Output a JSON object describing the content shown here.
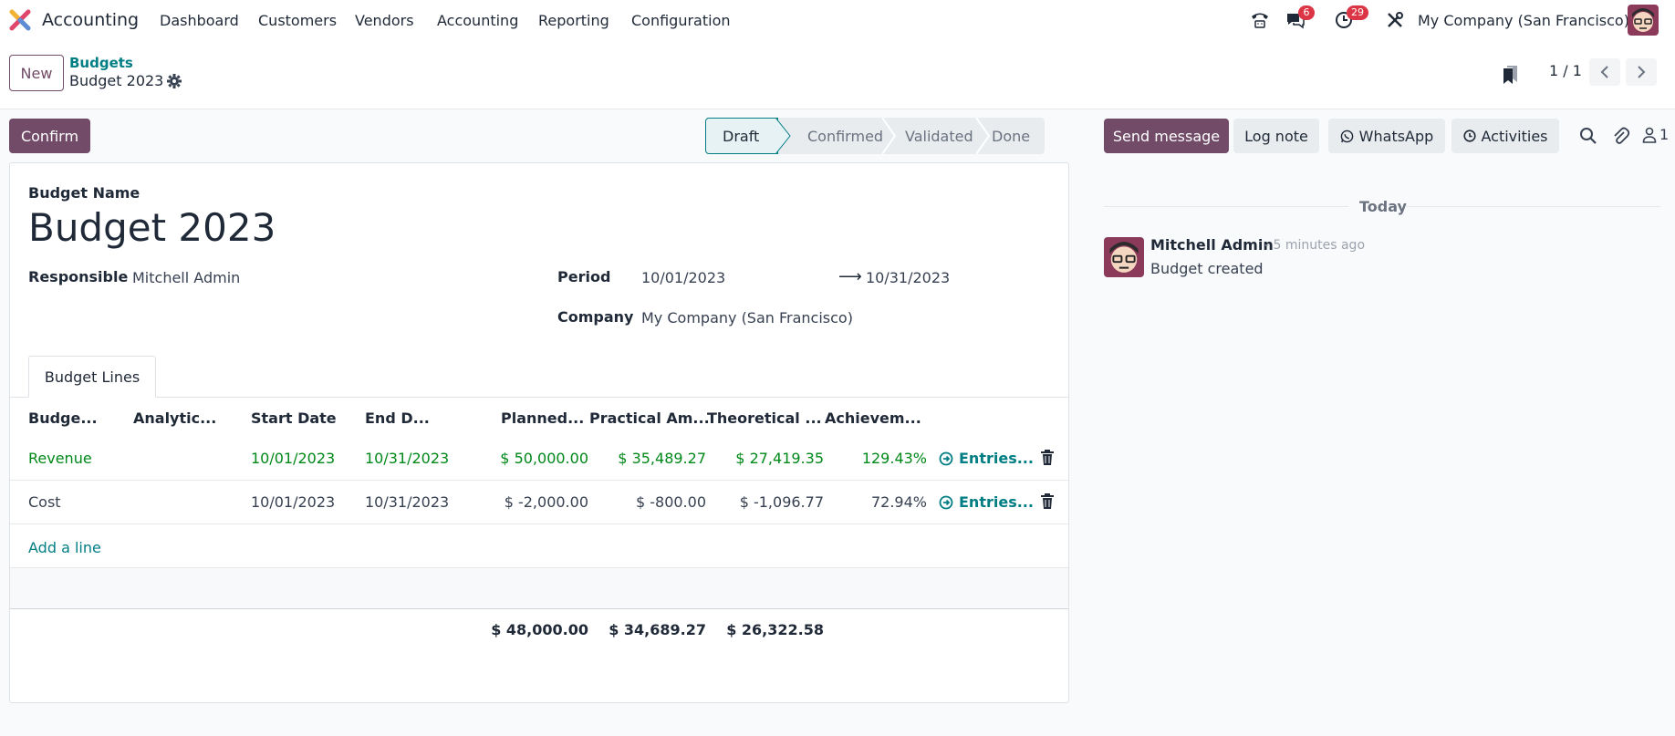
{
  "navbar": {
    "app_name": "Accounting",
    "menu": [
      "Dashboard",
      "Customers",
      "Vendors",
      "Accounting",
      "Reporting",
      "Configuration"
    ],
    "messages_badge": "6",
    "activities_badge": "29",
    "company": "My Company (San Francisco)"
  },
  "control_panel": {
    "new_label": "New",
    "breadcrumb": "Budgets",
    "record_title": "Budget 2023",
    "pager": "1 / 1"
  },
  "statusbar": {
    "confirm_label": "Confirm",
    "stages": [
      "Draft",
      "Confirmed",
      "Validated",
      "Done"
    ],
    "active_stage": "Draft"
  },
  "form": {
    "budget_name_label": "Budget Name",
    "budget_name": "Budget 2023",
    "responsible_label": "Responsible",
    "responsible": "Mitchell Admin",
    "period_label": "Period",
    "period_start": "10/01/2023",
    "period_end": "10/31/2023",
    "company_label": "Company",
    "company": "My Company (San Francisco)",
    "tab_label": "Budget Lines",
    "columns": [
      "Budge...",
      "Analytic...",
      "Start Date",
      "End D...",
      "Planned...",
      "Practical Am...",
      "Theoretical ...",
      "Achievem..."
    ],
    "rows": [
      {
        "budget": "Revenue",
        "analytic": "",
        "start": "10/01/2023",
        "end": "10/31/2023",
        "planned": "$ 50,000.00",
        "practical": "$ 35,489.27",
        "theoretical": "$ 27,419.35",
        "achievement": "129.43%",
        "entries": "Entries..."
      },
      {
        "budget": "Cost",
        "analytic": "",
        "start": "10/01/2023",
        "end": "10/31/2023",
        "planned": "$ -2,000.00",
        "practical": "$ -800.00",
        "theoretical": "$ -1,096.77",
        "achievement": "72.94%",
        "entries": "Entries..."
      }
    ],
    "add_line": "Add a line",
    "totals": {
      "planned": "$ 48,000.00",
      "practical": "$ 34,689.27",
      "theoretical": "$ 26,322.58"
    }
  },
  "chatter": {
    "send_message": "Send message",
    "log_note": "Log note",
    "whatsapp": "WhatsApp",
    "activities": "Activities",
    "followers": "1",
    "today": "Today",
    "message": {
      "author": "Mitchell Admin",
      "time": "- 5 minutes ago",
      "body": "Budget created"
    }
  },
  "colors": {
    "brand": "#714b67",
    "link": "#017e84",
    "positive": "#008818",
    "badge": "#dc3545"
  }
}
